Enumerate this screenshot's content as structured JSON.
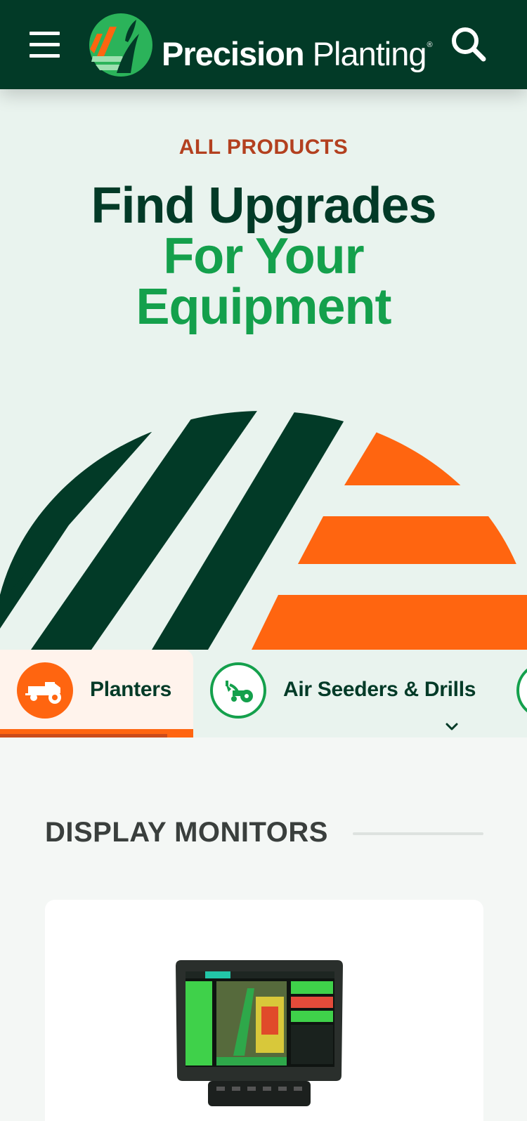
{
  "header": {
    "brand_bold": "Precision",
    "brand_light": "Planting",
    "brand_mark": "®",
    "menu_icon": "hamburger-menu-icon",
    "search_icon": "search-icon",
    "colors": {
      "background": "#023a27",
      "text": "#ffffff"
    }
  },
  "hero": {
    "eyebrow": "ALL PRODUCTS",
    "headline_line1": "Find Upgrades",
    "headline_line2": "For Your",
    "headline_line3": "Equipment",
    "colors": {
      "eyebrow": "#b3401f",
      "dark": "#023a27",
      "green": "#14a04c",
      "orange": "#ff6510",
      "background": "#e9f3ee"
    }
  },
  "tabs": [
    {
      "label": "Planters",
      "icon": "planter-icon",
      "active": true
    },
    {
      "label": "Air Seeders & Drills",
      "icon": "seeder-icon",
      "active": false
    },
    {
      "label": "",
      "icon": "partial-category-icon",
      "active": false
    }
  ],
  "tabs_more_icon": "chevron-down-icon",
  "section": {
    "title": "DISPLAY MONITORS"
  },
  "product_card": {
    "image_icon": "display-monitor-image"
  }
}
